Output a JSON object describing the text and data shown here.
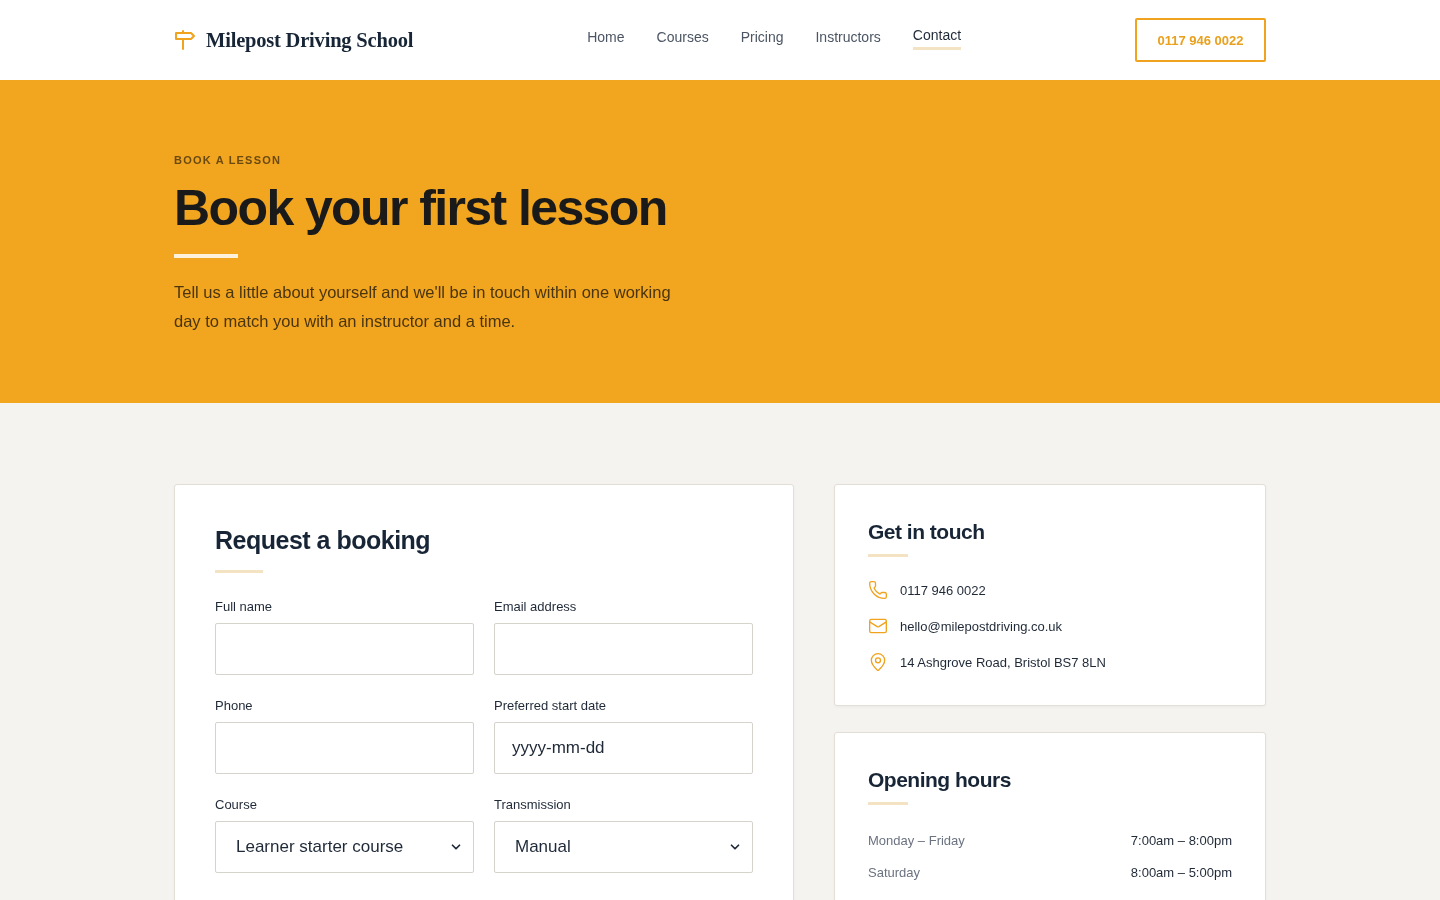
{
  "header": {
    "brand": "Milepost Driving School",
    "nav": [
      {
        "label": "Home",
        "selected": false
      },
      {
        "label": "Courses",
        "selected": false
      },
      {
        "label": "Pricing",
        "selected": false
      },
      {
        "label": "Instructors",
        "selected": false
      },
      {
        "label": "Contact",
        "selected": true
      }
    ],
    "phone_button": "0117 946 0022"
  },
  "hero": {
    "eyebrow": "BOOK A LESSON",
    "title": "Book your first lesson",
    "text": "Tell us a little about yourself and we'll be in touch within one working day to match you with an instructor and a time."
  },
  "booking_form": {
    "title": "Request a booking",
    "fields": [
      {
        "label": "Full name",
        "kind": "text"
      },
      {
        "label": "Email address",
        "kind": "text"
      },
      {
        "label": "Phone",
        "kind": "text"
      },
      {
        "label": "Preferred start date",
        "kind": "date",
        "placeholder": "yyyy-mm-dd"
      },
      {
        "label": "Course",
        "kind": "select",
        "value": "Learner starter course"
      },
      {
        "label": "Transmission",
        "kind": "select",
        "value": "Manual"
      }
    ]
  },
  "contact_card": {
    "title": "Get in touch",
    "items": [
      {
        "kind": "phone",
        "text": "0117 946 0022"
      },
      {
        "kind": "email",
        "text": "hello@milepostdriving.co.uk"
      },
      {
        "kind": "address",
        "text": "14 Ashgrove Road, Bristol BS7 8LN"
      }
    ]
  },
  "hours_card": {
    "title": "Opening hours",
    "rows": [
      {
        "day": "Monday – Friday",
        "time": "7:00am – 8:00pm"
      },
      {
        "day": "Saturday",
        "time": "8:00am – 5:00pm"
      }
    ]
  }
}
